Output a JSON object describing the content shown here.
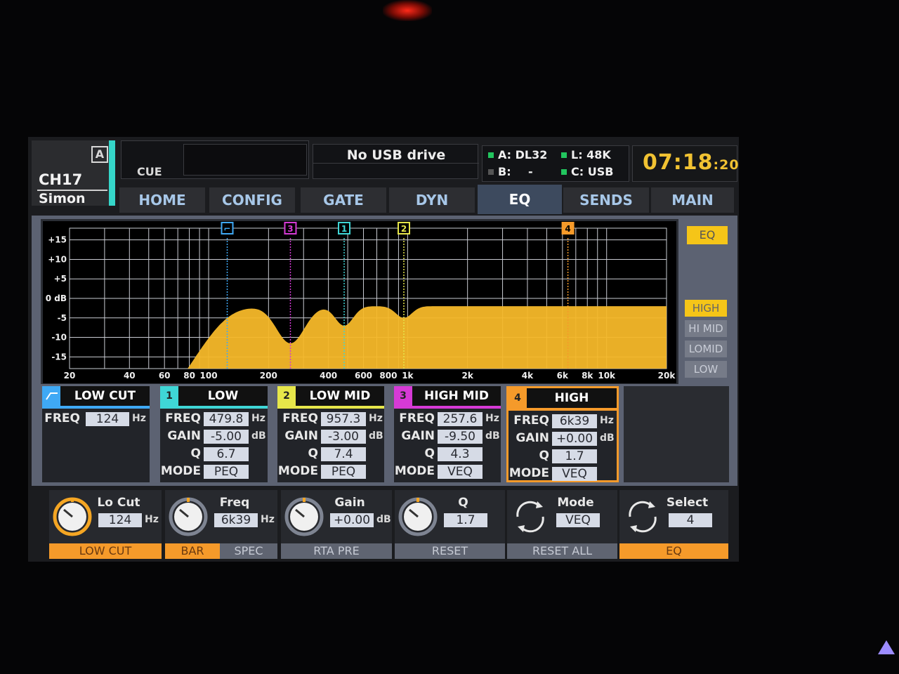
{
  "channel": {
    "badge": "A",
    "id": "CH17",
    "name": "Simon",
    "color": "#35d6c9"
  },
  "cue": {
    "label": "CUE"
  },
  "usb": {
    "label": "No USB drive"
  },
  "status": {
    "a": "A: DL32",
    "b": "B:",
    "b_value": "-",
    "l": "L: 48K",
    "c": "C: USB",
    "led_on": "#22c55e",
    "led_off": "#555555"
  },
  "clock": {
    "hm": "07:18",
    "sec": ":20",
    "color": "#f1c232"
  },
  "tabs": [
    "HOME",
    "CONFIG",
    "GATE",
    "DYN",
    "EQ",
    "SENDS",
    "MAIN"
  ],
  "active_tab": "EQ",
  "graph": {
    "db_labels": [
      "+15",
      "+10",
      "+5",
      "0 dB",
      "-5",
      "-10",
      "-15"
    ],
    "freq_labels": [
      "20",
      "40",
      "60",
      "80",
      "100",
      "200",
      "400",
      "600",
      "800",
      "1k",
      "2k",
      "4k",
      "6k",
      "8k",
      "10k",
      "20k"
    ],
    "markers": [
      {
        "id": "lowcut",
        "label": "⌐",
        "color": "#3fa9f5"
      },
      {
        "id": "3",
        "label": "3",
        "color": "#d63ad6"
      },
      {
        "id": "1",
        "label": "1",
        "color": "#3fd6d6"
      },
      {
        "id": "2",
        "label": "2",
        "color": "#e6e64a"
      },
      {
        "id": "4",
        "label": "4",
        "color": "#f59a2a"
      }
    ],
    "curve_color": "#f5b829"
  },
  "eq_badge": "EQ",
  "band_selectors": [
    "HIGH",
    "HI MID",
    "LOMID",
    "LOW"
  ],
  "active_band_selector": "HIGH",
  "bands": [
    {
      "id": "lowcut",
      "num": "",
      "title": "LOW CUT",
      "color": "#3fa9f5",
      "params": [
        {
          "label": "FREQ",
          "value": "124",
          "unit": "Hz"
        }
      ]
    },
    {
      "id": "low",
      "num": "1",
      "title": "LOW",
      "color": "#3fd6d6",
      "params": [
        {
          "label": "FREQ",
          "value": "479.8",
          "unit": "Hz"
        },
        {
          "label": "GAIN",
          "value": "-5.00",
          "unit": "dB"
        },
        {
          "label": "Q",
          "value": "6.7",
          "unit": ""
        },
        {
          "label": "MODE",
          "value": "PEQ",
          "unit": ""
        }
      ]
    },
    {
      "id": "lowmid",
      "num": "2",
      "title": "LOW MID",
      "color": "#e6e64a",
      "params": [
        {
          "label": "FREQ",
          "value": "957.3",
          "unit": "Hz"
        },
        {
          "label": "GAIN",
          "value": "-3.00",
          "unit": "dB"
        },
        {
          "label": "Q",
          "value": "7.4",
          "unit": ""
        },
        {
          "label": "MODE",
          "value": "PEQ",
          "unit": ""
        }
      ]
    },
    {
      "id": "highmid",
      "num": "3",
      "title": "HIGH MID",
      "color": "#d63ad6",
      "params": [
        {
          "label": "FREQ",
          "value": "257.6",
          "unit": "Hz"
        },
        {
          "label": "GAIN",
          "value": "-9.50",
          "unit": "dB"
        },
        {
          "label": "Q",
          "value": "4.3",
          "unit": ""
        },
        {
          "label": "MODE",
          "value": "VEQ",
          "unit": ""
        }
      ]
    },
    {
      "id": "high",
      "num": "4",
      "title": "HIGH",
      "color": "#f59a2a",
      "params": [
        {
          "label": "FREQ",
          "value": "6k39",
          "unit": "Hz"
        },
        {
          "label": "GAIN",
          "value": "+0.00",
          "unit": "dB"
        },
        {
          "label": "Q",
          "value": "1.7",
          "unit": ""
        },
        {
          "label": "MODE",
          "value": "VEQ",
          "unit": ""
        }
      ]
    }
  ],
  "encoders": [
    {
      "id": "locut",
      "title": "Lo Cut",
      "value": "124",
      "unit": "Hz",
      "knob": "orange"
    },
    {
      "id": "freq",
      "title": "Freq",
      "value": "6k39",
      "unit": "Hz",
      "knob": "grey"
    },
    {
      "id": "gain",
      "title": "Gain",
      "value": "+0.00",
      "unit": "dB",
      "knob": "grey"
    },
    {
      "id": "q",
      "title": "Q",
      "value": "1.7",
      "unit": "",
      "knob": "grey"
    },
    {
      "id": "mode",
      "title": "Mode",
      "value": "VEQ",
      "unit": "",
      "knob": "arrows"
    },
    {
      "id": "select",
      "title": "Select",
      "value": "4",
      "unit": "",
      "knob": "arrows"
    }
  ],
  "softkeys": {
    "low_cut": "LOW CUT",
    "bar": "BAR",
    "spec": "SPEC",
    "rta_pre": "RTA PRE",
    "reset": "RESET",
    "reset_all": "RESET ALL",
    "eq": "EQ"
  }
}
